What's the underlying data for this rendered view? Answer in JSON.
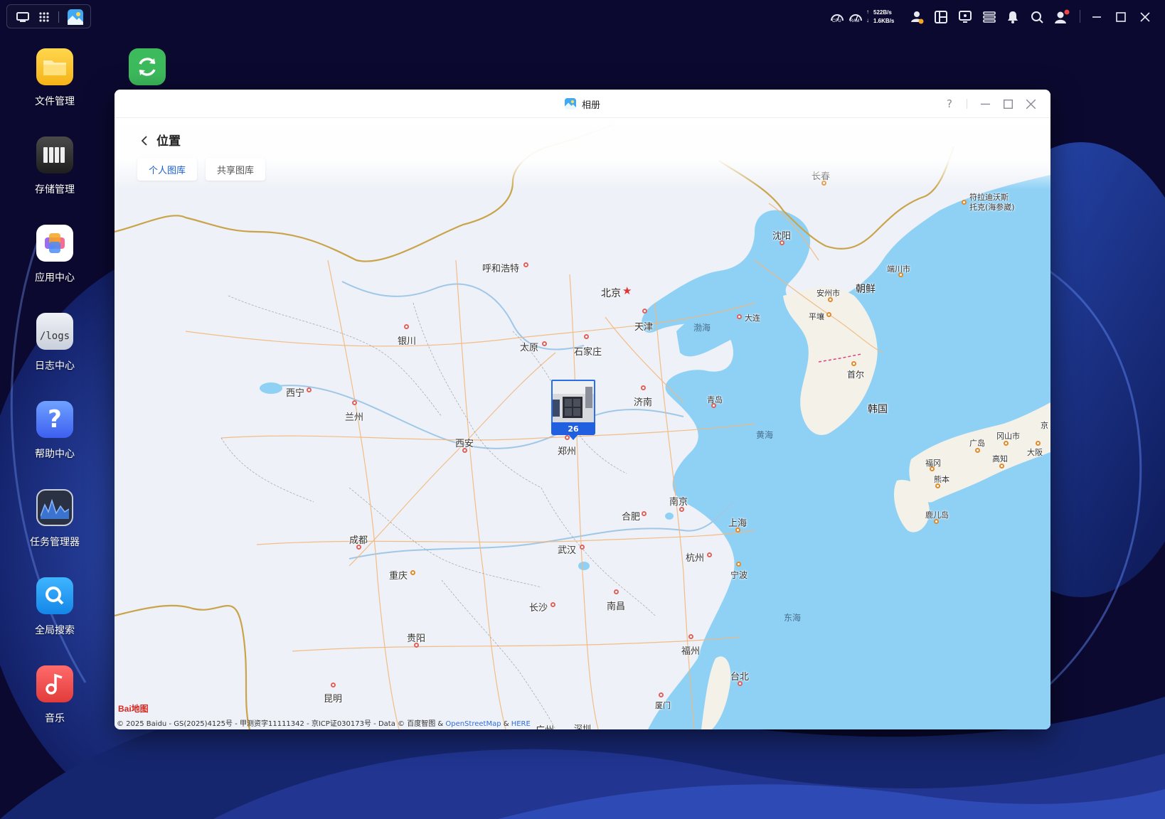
{
  "topbar": {
    "cpu_label": "CPU",
    "ram_label": "RAM",
    "upload_speed": "522B/s",
    "download_speed": "1.6KB/s"
  },
  "desktop_icons": [
    {
      "label": "文件管理",
      "icon": "folder-icon"
    },
    {
      "label": "存储管理",
      "icon": "storage-icon"
    },
    {
      "label": "应用中心",
      "icon": "app-center-icon"
    },
    {
      "label": "日志中心",
      "icon": "logs-icon",
      "glyph": "/logs"
    },
    {
      "label": "帮助中心",
      "icon": "help-icon",
      "glyph": "?"
    },
    {
      "label": "任务管理器",
      "icon": "task-manager-icon"
    },
    {
      "label": "全局搜索",
      "icon": "search-icon"
    },
    {
      "label": "音乐",
      "icon": "music-icon"
    }
  ],
  "window": {
    "title": "相册",
    "help_glyph": "?",
    "page_title": "位置",
    "tabs": [
      {
        "label": "个人图库",
        "active": true
      },
      {
        "label": "共享图库",
        "active": false
      }
    ]
  },
  "map": {
    "cities": [
      "长春",
      "符拉迪沃斯",
      "托克(海参崴)",
      "沈阳",
      "端川市",
      "呼和浩特",
      "北京",
      "安州市",
      "朝鲜",
      "大连",
      "平壤",
      "天津",
      "渤海",
      "银川",
      "太原",
      "石家庄",
      "首尔",
      "西宁",
      "兰州",
      "济南",
      "青岛",
      "韩国",
      "西安",
      "郑州",
      "黄海",
      "广岛",
      "冈山市",
      "大阪",
      "京",
      "福冈",
      "高知",
      "熊本",
      "南京",
      "合肥",
      "上海",
      "鹿儿岛",
      "成都",
      "武汉",
      "杭州",
      "重庆",
      "宁波",
      "长沙",
      "南昌",
      "东海",
      "贵阳",
      "福州",
      "台北",
      "昆明",
      "厦门",
      "广州",
      "深圳"
    ],
    "photo_cluster_count": "26",
    "baidu_logo": "Bai地图",
    "copyright": {
      "prefix": "© 2025 Baidu - GS(2025)4125号 - 甲测资字11111342 - 京ICP证030173号 - Data © 百度智图 & ",
      "osm": "OpenStreetMap",
      "amp": " & ",
      "here": "HERE"
    }
  },
  "colors": {
    "accent": "#1a5fd0",
    "sea": "#8fd1f5",
    "land": "#eef1f7",
    "desktop": "#0d0b2e"
  }
}
